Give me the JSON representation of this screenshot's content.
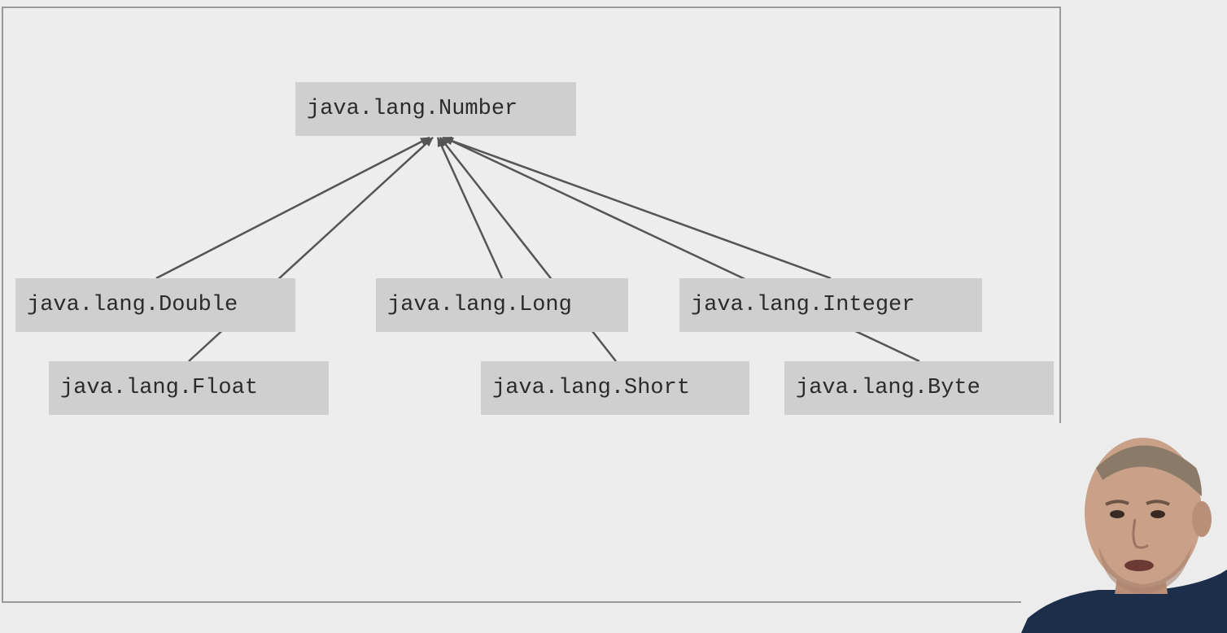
{
  "diagram": {
    "nodes": [
      {
        "id": "number",
        "label": "java.lang.Number"
      },
      {
        "id": "double",
        "label": "java.lang.Double"
      },
      {
        "id": "long",
        "label": "java.lang.Long"
      },
      {
        "id": "integer",
        "label": "java.lang.Integer"
      },
      {
        "id": "float",
        "label": "java.lang.Float"
      },
      {
        "id": "short",
        "label": "java.lang.Short"
      },
      {
        "id": "byte",
        "label": "java.lang.Byte"
      }
    ],
    "edges": [
      {
        "from": "double",
        "to": "number"
      },
      {
        "from": "float",
        "to": "number"
      },
      {
        "from": "long",
        "to": "number"
      },
      {
        "from": "short",
        "to": "number"
      },
      {
        "from": "integer",
        "to": "number"
      },
      {
        "from": "byte",
        "to": "number"
      }
    ],
    "colors": {
      "node_fill": "#cfcfcf",
      "edge": "#555555",
      "background": "#ededed"
    }
  }
}
